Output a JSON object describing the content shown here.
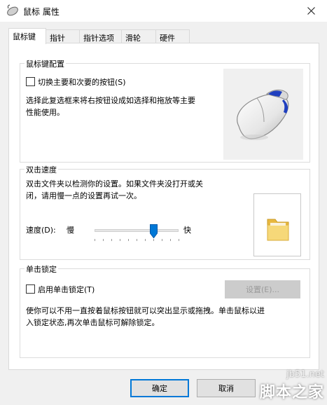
{
  "window": {
    "title": "鼠标 属性"
  },
  "tabs": [
    "鼠标键",
    "指针",
    "指针选项",
    "滑轮",
    "硬件"
  ],
  "button_config": {
    "group_title": "鼠标键配置",
    "checkbox_label": "切换主要和次要的按钮(S)",
    "checked": false,
    "description_line1": "选择此复选框来将右按钮设成如选择和拖放等主要",
    "description_line2": "性能使用。"
  },
  "double_click": {
    "group_title": "双击速度",
    "description_line1": "双击文件夹以检测你的设置。如果文件夹没打开或关",
    "description_line2": "闭，请用慢一点的设置再试一次。",
    "speed_label": "速度(D):",
    "slow_label": "慢",
    "fast_label": "快",
    "slider_fraction": 0.7
  },
  "click_lock": {
    "group_title": "单击锁定",
    "checkbox_label": "启用单击锁定(T)",
    "checked": false,
    "settings_button": "设置(E)...",
    "description_line1": "使你可以不用一直按着鼠标按钮就可以突出显示或拖拽。单击鼠标以进",
    "description_line2": "入锁定状态,再次单击鼠标可解除锁定。"
  },
  "footer": {
    "ok_button": "确定",
    "cancel_button": "取消"
  },
  "watermark": {
    "url": "jb51.net",
    "text": "脚本之家"
  },
  "colors": {
    "accent": "#0078d7",
    "mouse_blue": "#1f3fbf"
  }
}
